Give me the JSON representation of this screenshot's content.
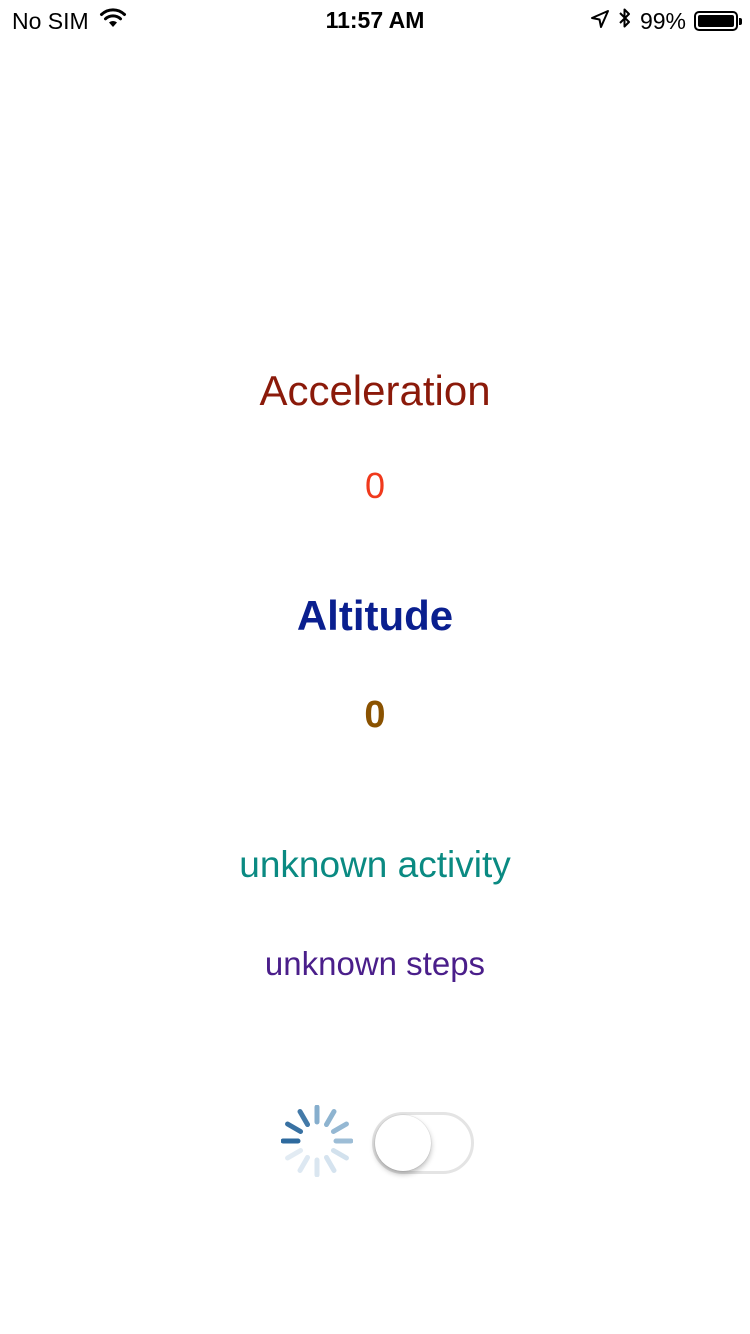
{
  "status_bar": {
    "carrier": "No SIM",
    "time": "11:57 AM",
    "battery_percent": "99%",
    "battery_level": 0.99,
    "icons": [
      "wifi-icon",
      "location-arrow-icon",
      "bluetooth-icon",
      "battery-icon"
    ]
  },
  "acceleration": {
    "title": "Acceleration",
    "value": "0",
    "title_color": "#8b1a0a",
    "value_color": "#f0391c"
  },
  "altitude": {
    "title": "Altitude",
    "value": "0",
    "title_color": "#0a1f8f",
    "value_color": "#8a5200"
  },
  "activity": {
    "text": "unknown activity",
    "color": "#0a8a82"
  },
  "steps": {
    "text": "unknown steps",
    "color": "#4a1e8a"
  },
  "controls": {
    "activity_indicator": "spinner-icon",
    "toggle_on": false
  }
}
